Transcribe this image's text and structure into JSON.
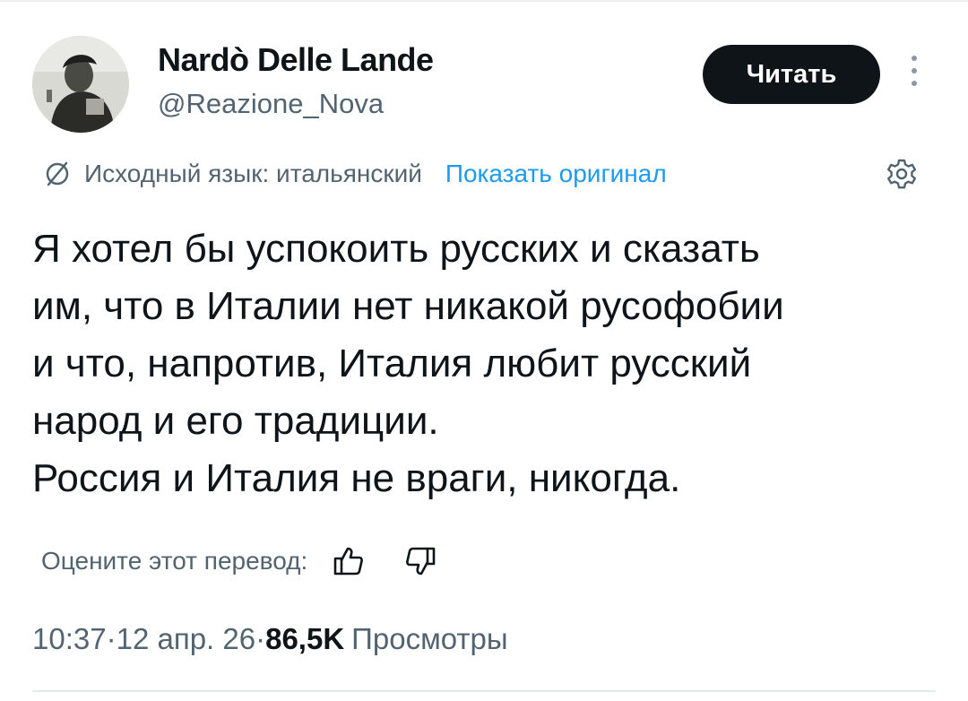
{
  "author": {
    "display_name": "Nardò Delle Lande",
    "handle": "@Reazione_Nova"
  },
  "follow_button_label": "Читать",
  "translation": {
    "source_language_label": "Исходный язык: итальянский",
    "show_original_label": "Показать оригинал"
  },
  "tweet": {
    "lines": [
      "Я хотел бы успокоить русских и сказать",
      "им, что в Италии нет никакой русофобии",
      "и что, напротив, Италия любит русский",
      "народ и его традиции.",
      "Россия и Италия не враги, никогда."
    ]
  },
  "rate": {
    "label": "Оцените этот перевод:"
  },
  "meta": {
    "time": "10:37",
    "separator": " · ",
    "date": "12 апр. 26",
    "views_count": "86,5K",
    "views_label": "Просмотры"
  },
  "icons": {
    "more": "more-vertical-icon",
    "translate": "translate-icon",
    "settings": "gear-icon",
    "like_translation": "thumbs-up-icon",
    "dislike_translation": "thumbs-down-icon"
  },
  "colors": {
    "text": "#0f1419",
    "muted": "#536471",
    "link": "#1d9bf0",
    "button_bg": "#0f1419"
  }
}
